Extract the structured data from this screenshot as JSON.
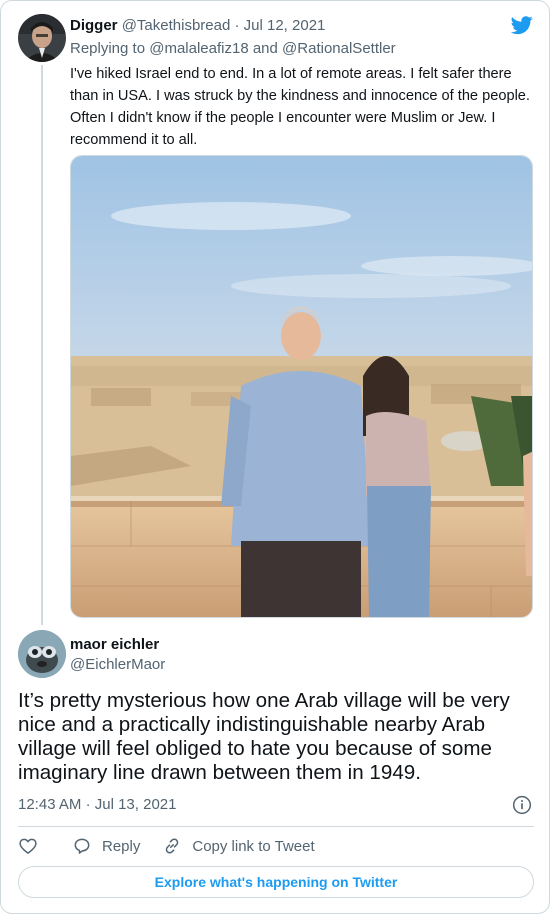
{
  "parent_tweet": {
    "author_name": "Digger",
    "author_handle": "@Takethisbread",
    "separator": "·",
    "date": "Jul 12, 2021",
    "replying_prefix": "Replying to",
    "replying_to": [
      "@malaleafiz18",
      "@RationalSettler"
    ],
    "replying_joiner": "and",
    "text": "I've hiked Israel end to end. In a lot of remote areas. I felt safer there than in USA. I was struck by the kindness and innocence of the people. Often I didn't know if the people I encounter were Muslim or Jew. I recommend it to all."
  },
  "main_tweet": {
    "author_name": "maor eichler",
    "author_handle": "@EichlerMaor",
    "text": "It’s pretty mysterious how one Arab village will be very nice and a practically indistinguishable nearby Arab village will feel obliged to hate you because of some imaginary line drawn between them in 1949.",
    "time": "12:43 AM",
    "separator": "·",
    "date": "Jul 13, 2021"
  },
  "actions": {
    "reply_label": "Reply",
    "copy_label": "Copy link to Tweet"
  },
  "explore_label": "Explore what's happening on Twitter",
  "icons": {
    "brand": "twitter-bird-icon",
    "info": "info-icon",
    "like": "heart-icon",
    "reply": "speech-bubble-icon",
    "copy": "link-icon"
  },
  "colors": {
    "accent": "#1d9bf0",
    "muted_text": "#536471",
    "text": "#0f1419",
    "border": "#cfd9de"
  }
}
